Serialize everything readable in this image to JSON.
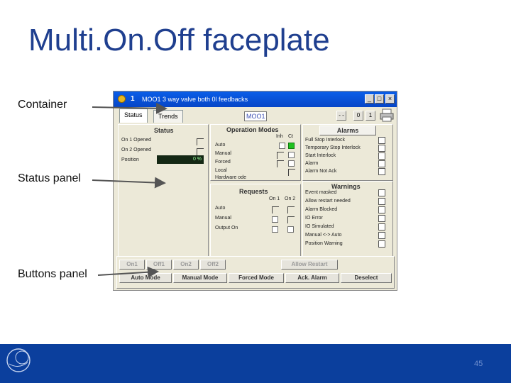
{
  "slide": {
    "title": "Multi.On.Off faceplate",
    "callouts": [
      "Container",
      "Status panel",
      "Buttons panel"
    ],
    "page_number": "45"
  },
  "window": {
    "number": "1",
    "title": "MOO1 3 way valve   both 0l feedbacks",
    "controls": [
      "_",
      "□",
      "×"
    ]
  },
  "tabs": [
    "Status",
    "Trends"
  ],
  "device_field": "MOO1",
  "small_buttons": [
    "- -",
    "0",
    "1"
  ],
  "status_panel": {
    "title": "Status",
    "rows": [
      "On 1 Opened",
      "On 2 Opened",
      "Position"
    ],
    "position_value": "0 %"
  },
  "operation_modes": {
    "title": "Operation Modes",
    "headers": [
      "Inh",
      "Ct"
    ],
    "rows": [
      "Auto",
      "Manual",
      "Forced",
      "Local",
      "Hardware   ode"
    ],
    "active_index": 0
  },
  "requests": {
    "title": "Requests",
    "headers": [
      "On 1",
      "On 2"
    ],
    "rows": [
      "Auto",
      "Manual",
      "Output On"
    ]
  },
  "alarms": {
    "title": "Alarms",
    "rows": [
      "Full Stop Interlock",
      "Temporary Stop Interlock",
      "Start Interlock",
      "Alarm",
      "Alarm Not Ack"
    ]
  },
  "warnings": {
    "title": "Warnings",
    "rows": [
      "Event masked",
      "Allow restart needed",
      "Alarm Blocked",
      "IO Error",
      "IO Simulated",
      "Manual <-> Auto",
      "Position Warning"
    ]
  },
  "buttons_top": [
    "On1",
    "Off1",
    "On2",
    "Off2",
    "Allow Restart"
  ],
  "buttons_bottom": [
    "Auto Mode",
    "Manual Mode",
    "Forced Mode",
    "Ack. Alarm",
    "Deselect"
  ],
  "colors": {
    "title_text": "#1f3f8f",
    "footer": "#0b3f9d",
    "titlebar": "#0645c7",
    "active_indicator": "#1fc11f"
  }
}
